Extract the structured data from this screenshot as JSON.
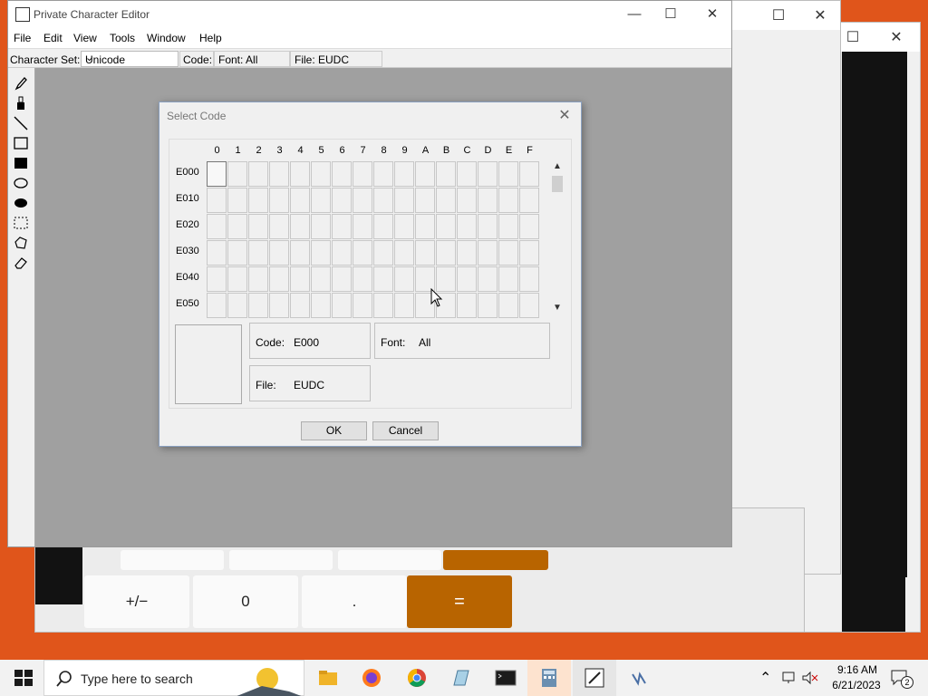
{
  "main_window": {
    "title": "Private Character Editor",
    "controls": {
      "minimize": "—",
      "maximize": "☐",
      "close": "✕"
    },
    "menu": [
      "File",
      "Edit",
      "View",
      "Tools",
      "Window",
      "Help"
    ],
    "info_bar": {
      "charset_label": "Character Set:",
      "charset_value": "Unicode",
      "code_label": "Code:",
      "font_label": "Font: All",
      "file_label": "File: EUDC"
    },
    "tools": [
      "pencil-icon",
      "brush-icon",
      "line-icon",
      "hollow-rectangle-icon",
      "filled-rectangle-icon",
      "hollow-ellipse-icon",
      "filled-ellipse-icon",
      "rectangular-selection-icon",
      "freeform-selection-icon",
      "eraser-icon"
    ]
  },
  "dialog": {
    "title": "Select Code",
    "close": "✕",
    "columns": [
      "0",
      "1",
      "2",
      "3",
      "4",
      "5",
      "6",
      "7",
      "8",
      "9",
      "A",
      "B",
      "C",
      "D",
      "E",
      "F"
    ],
    "rows": [
      "E000",
      "E010",
      "E020",
      "E030",
      "E040",
      "E050"
    ],
    "selected_cell": {
      "row": 0,
      "col": 0
    },
    "scroll_up": "▲",
    "scroll_down": "▼",
    "code_key": "Code:",
    "code_value": "E000",
    "font_key": "Font:",
    "font_value": "All",
    "file_key": "File:",
    "file_value": "EUDC",
    "ok_label": "OK",
    "cancel_label": "Cancel"
  },
  "calculator": {
    "keys": [
      "+/−",
      "0",
      ".",
      "="
    ],
    "equals_color": "#b86400"
  },
  "background_windows": {
    "controls": {
      "minimize": "—",
      "maximize": "☐",
      "close": "✕"
    }
  },
  "taskbar": {
    "search_placeholder": "Type here to search",
    "apps": [
      "file-explorer-icon",
      "firefox-icon",
      "chrome-icon",
      "notepad-icon",
      "terminal-icon",
      "calculator-icon",
      "private-character-editor-icon",
      "app-icon"
    ],
    "time": "9:16 AM",
    "date": "6/21/2023",
    "notification_count": "2"
  },
  "colors": {
    "desktop": "#e0551b",
    "canvas": "#a0a0a0",
    "calc_equals": "#b86400"
  }
}
